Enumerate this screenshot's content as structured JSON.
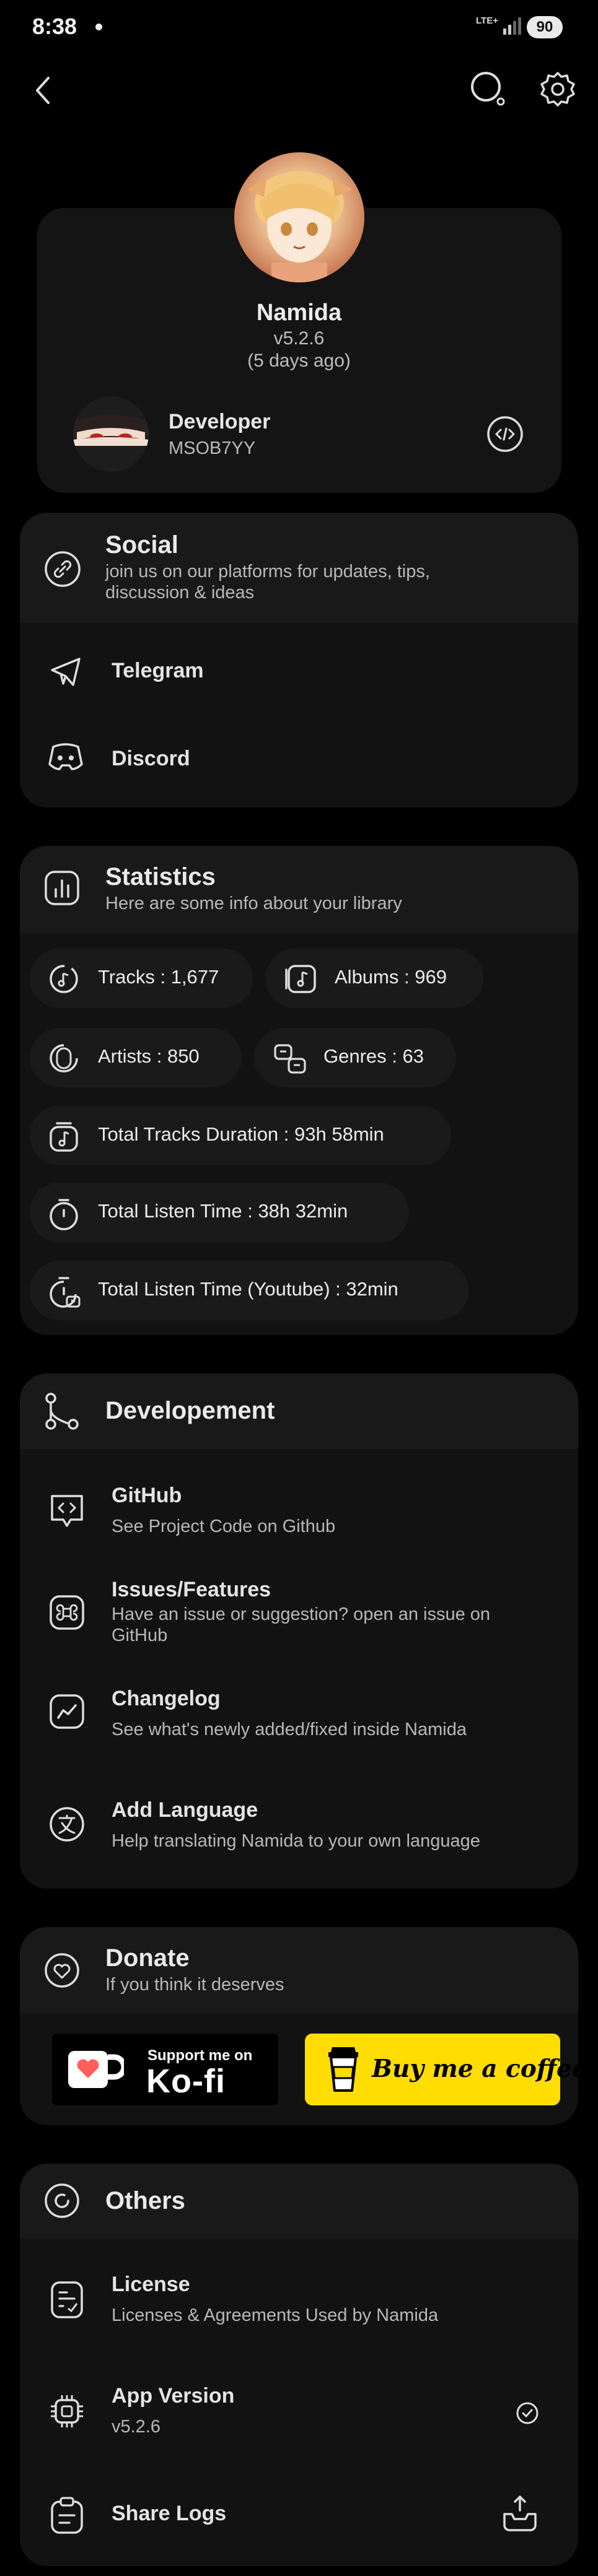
{
  "status_bar": {
    "time": "8:38",
    "network": "LTE+",
    "battery": "90"
  },
  "header": {
    "back_icon": "chevron-left-icon",
    "search_icon": "search-icon",
    "settings_icon": "gear-icon"
  },
  "profile": {
    "app_name": "Namida",
    "version": "v5.2.6",
    "released": "(5 days ago)",
    "developer_role": "Developer",
    "developer_name": "MSOB7YY",
    "source_icon": "code-icon"
  },
  "social": {
    "title": "Social",
    "subtitle_line1": "join us on our platforms for updates, tips,",
    "subtitle_line2": "discussion & ideas",
    "items": [
      {
        "label": "Telegram",
        "icon": "telegram-icon"
      },
      {
        "label": "Discord",
        "icon": "discord-icon"
      }
    ]
  },
  "statistics": {
    "title": "Statistics",
    "subtitle": "Here are some info about your library",
    "tracks": "Tracks :  1,677",
    "albums": "Albums :  969",
    "artists": "Artists :  850",
    "genres": "Genres :  63",
    "total_duration": "Total Tracks Duration :  93h 58min",
    "listen_time": "Total Listen Time :  38h 32min",
    "listen_time_youtube": "Total Listen Time (Youtube) :  32min"
  },
  "development": {
    "title": "Developement",
    "items": [
      {
        "title": "GitHub",
        "subtitle": "See Project Code on Github"
      },
      {
        "title": "Issues/Features",
        "subtitle_line1": "Have an issue or suggestion? open an issue on",
        "subtitle_line2": "GitHub"
      },
      {
        "title": "Changelog",
        "subtitle": "See what's newly added/fixed inside Namida"
      },
      {
        "title": "Add Language",
        "subtitle": "Help translating Namida to your own language"
      }
    ]
  },
  "donate": {
    "title": "Donate",
    "subtitle": "If you think it deserves",
    "kofi_top": "Support me on",
    "kofi_brand": "Ko-fi",
    "bmc_label": "Buy me a coffee"
  },
  "others": {
    "title": "Others",
    "items": [
      {
        "title": "License",
        "subtitle": "Licenses & Agreements Used by Namida"
      },
      {
        "title": "App Version",
        "subtitle": "v5.2.6"
      },
      {
        "title": "Share Logs"
      }
    ]
  },
  "colors": {
    "background": "#000000",
    "card": "#121212",
    "chip": "#1a1a1a",
    "kofi_red": "#ff5e5b",
    "bmc_yellow": "#ffdd00"
  }
}
